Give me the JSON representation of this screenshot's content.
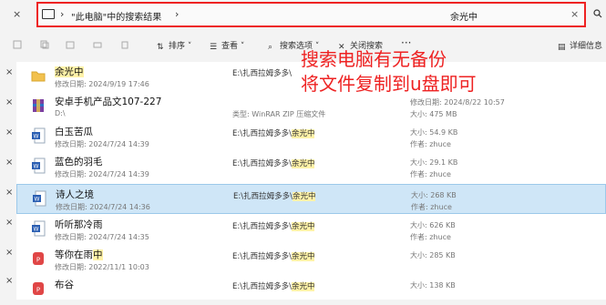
{
  "address": {
    "left_close": "×",
    "crumb": "\"此电脑\"中的搜索结果",
    "query": "余光中",
    "clear": "×"
  },
  "toolbar": {
    "sort": "排序",
    "view": "查看",
    "search_options": "搜索选项",
    "close_search": "关闭搜索",
    "more": "···",
    "details": "详细信息"
  },
  "annotation": {
    "line1": "搜索电脑有无备份",
    "line2": "将文件复制到u盘即可"
  },
  "files": [
    {
      "name": "余光中",
      "name_pre": "",
      "name_hl": "余光中",
      "sub": "修改日期: 2024/9/19 17:46",
      "path_pre": "E:\\扎西拉姆多多\\",
      "path_hl": "",
      "type": "",
      "c1": "",
      "c2": "",
      "icon": "folder-icon"
    },
    {
      "name": "安卓手机产品文107-227",
      "name_pre": "安卓手机产品文107-227",
      "name_hl": "",
      "sub": "D:\\",
      "path_pre": "",
      "path_hl": "",
      "type": "类型: WinRAR ZIP 压缩文件",
      "c1": "修改日期: 2024/8/22 10:57",
      "c2": "大小: 475 MB",
      "icon": "zip-archive-icon"
    },
    {
      "name": "白玉苦瓜",
      "name_pre": "白玉苦瓜",
      "name_hl": "",
      "sub": "修改日期: 2024/7/24 14:39",
      "path_pre": "E:\\扎西拉姆多多\\",
      "path_hl": "余光中",
      "type": "",
      "c1": "大小: 54.9 KB",
      "c2": "作者: zhuce",
      "icon": "word-doc-icon"
    },
    {
      "name": "蓝色的羽毛",
      "name_pre": "蓝色的羽毛",
      "name_hl": "",
      "sub": "修改日期: 2024/7/24 14:39",
      "path_pre": "E:\\扎西拉姆多多\\",
      "path_hl": "余光中",
      "type": "",
      "c1": "大小: 29.1 KB",
      "c2": "作者: zhuce",
      "icon": "word-doc-icon"
    },
    {
      "name": "诗人之境",
      "name_pre": "诗人之境",
      "name_hl": "",
      "sub": "修改日期: 2024/7/24 14:36",
      "path_pre": "E:\\扎西拉姆多多\\",
      "path_hl": "余光中",
      "type": "",
      "c1": "大小: 268 KB",
      "c2": "作者: zhuce",
      "icon": "word-doc-icon"
    },
    {
      "name": "听听那冷雨",
      "name_pre": "听听那冷雨",
      "name_hl": "",
      "sub": "修改日期: 2024/7/24 14:35",
      "path_pre": "E:\\扎西拉姆多多\\",
      "path_hl": "余光中",
      "type": "",
      "c1": "大小: 626 KB",
      "c2": "作者: zhuce",
      "icon": "word-doc-icon"
    },
    {
      "name": "等你在雨中",
      "name_pre": "等你在雨",
      "name_hl": "中",
      "sub": "修改日期: 2022/11/1 10:03",
      "path_pre": "E:\\扎西拉姆多多\\",
      "path_hl": "余光中",
      "type": "",
      "c1": "大小: 285 KB",
      "c2": "",
      "icon": "pdf-icon"
    },
    {
      "name": "布谷",
      "name_pre": "布谷",
      "name_hl": "",
      "sub": "",
      "path_pre": "E:\\扎西拉姆多多\\",
      "path_hl": "余光中",
      "type": "",
      "c1": "大小: 138 KB",
      "c2": "",
      "icon": "pdf-icon"
    }
  ],
  "colors": {
    "accent_red": "#e22",
    "selected_row": "#cfe6f7",
    "highlight": "#fff2a8"
  }
}
